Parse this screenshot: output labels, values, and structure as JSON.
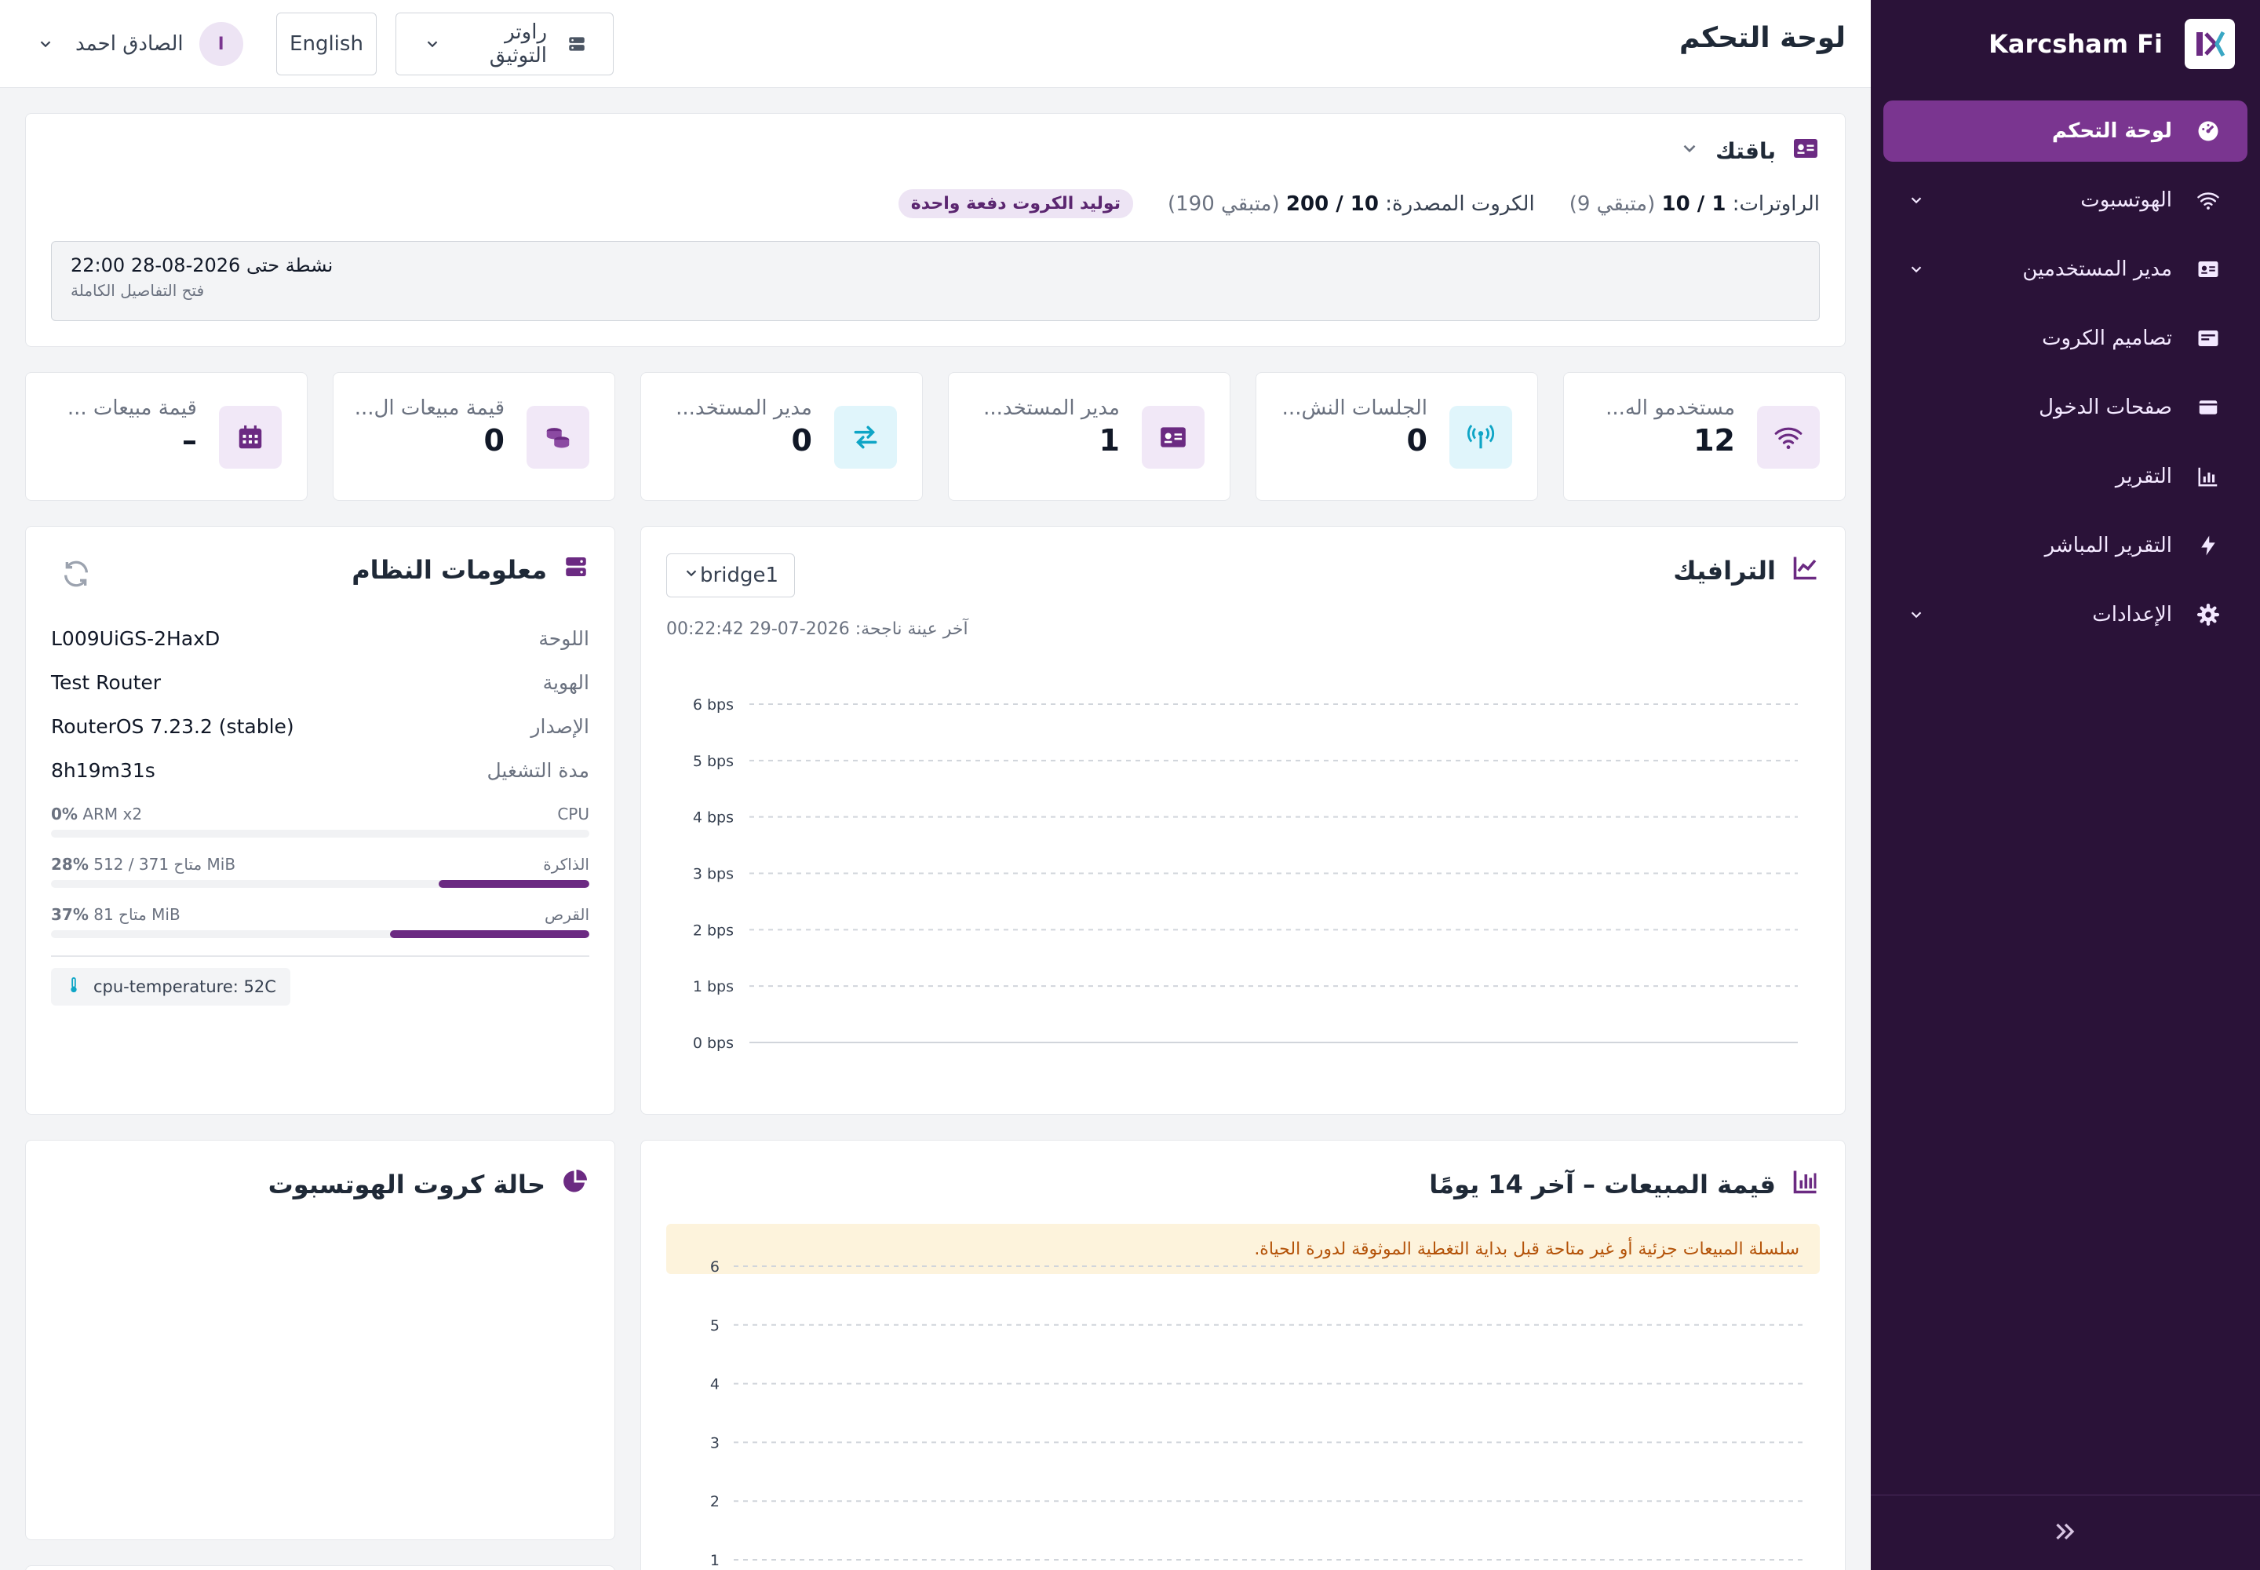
{
  "brand": {
    "name": "Karcsham Fi"
  },
  "sidebar": {
    "items": [
      {
        "label": "لوحة التحكم",
        "icon": "dashboard-icon",
        "active": true
      },
      {
        "label": "الهوتسبوت",
        "icon": "wifi-icon",
        "expandable": true
      },
      {
        "label": "مدير المستخدمين",
        "icon": "id-card-icon",
        "expandable": true
      },
      {
        "label": "تصاميم الكروت",
        "icon": "card-design-icon"
      },
      {
        "label": "صفحات الدخول",
        "icon": "login-page-icon"
      },
      {
        "label": "التقرير",
        "icon": "report-chart-icon"
      },
      {
        "label": "التقرير المباشر",
        "icon": "bolt-icon"
      },
      {
        "label": "الإعدادات",
        "icon": "gear-icon",
        "expandable": true
      }
    ]
  },
  "header": {
    "title": "لوحة التحكم",
    "router_select": "راوتر التوثيق",
    "language": "English",
    "user": {
      "name": "الصادق احمد",
      "initial": "ا"
    }
  },
  "package": {
    "title": "باقتك",
    "routers_label": "الراوترات:",
    "routers_used": "1",
    "routers_total": "10",
    "routers_remaining": "(متبقي 9)",
    "cards_label": "الكروت المصدرة:",
    "cards_used": "10",
    "cards_total": "200",
    "cards_remaining": "(متبقي 190)",
    "badge": "توليد الكروت دفعة واحدة",
    "active_until": "نشطة حتى 2026-08-28 22:00",
    "details_link": "فتح التفاصيل الكاملة"
  },
  "stats": [
    {
      "title": "مستخدمو اله...",
      "value": "12",
      "icon": "wifi-icon"
    },
    {
      "title": "الجلسات النش...",
      "value": "0",
      "icon": "antenna-icon"
    },
    {
      "title": "مدير المستخد...",
      "value": "1",
      "icon": "id-card-icon"
    },
    {
      "title": "مدير المستخد...",
      "value": "0",
      "icon": "transfer-icon"
    },
    {
      "title": "قيمة مبيعات ال...",
      "value": "0",
      "icon": "coins-icon"
    },
    {
      "title": "قيمة مبيعات ...",
      "value": "–",
      "icon": "calendar-icon"
    }
  ],
  "traffic": {
    "title": "الترافيك",
    "interface": "bridge1",
    "last_sample": "آخر عينة ناجحة: 2026-07-29 00:22:42",
    "y_ticks": [
      "0 bps",
      "1 bps",
      "2 bps",
      "3 bps",
      "4 bps",
      "5 bps",
      "6 bps"
    ]
  },
  "system": {
    "title": "معلومات النظام",
    "rows": [
      {
        "key": "اللوحة",
        "value": "L009UiGS-2HaxD"
      },
      {
        "key": "الهوية",
        "value": "Test Router"
      },
      {
        "key": "الإصدار",
        "value": "RouterOS 7.23.2 (stable)"
      },
      {
        "key": "مدة التشغيل",
        "value": "8h19m31s"
      }
    ],
    "meters": [
      {
        "label": "CPU",
        "detail": "ARM x2",
        "percent_text": "0%",
        "percent": 0
      },
      {
        "label": "الذاكرة",
        "detail": "متاح 371 / 512 MiB",
        "percent_text": "28%",
        "percent": 28
      },
      {
        "label": "القرص",
        "detail": "متاح 81 MiB",
        "percent_text": "37%",
        "percent": 37
      }
    ],
    "temperature": "cpu-temperature: 52C"
  },
  "sales": {
    "title": "قيمة المبيعات – آخر 14 يومًا",
    "warning": "سلسلة المبيعات جزئية أو غير متاحة قبل بداية التغطية الموثوقة لدورة الحياة.",
    "y_ticks": [
      "1",
      "2",
      "3",
      "4",
      "5",
      "6"
    ]
  },
  "hotspot_cards": {
    "title": "حالة كروت الهوتسبوت"
  },
  "colors": {
    "sidebar": "#2a1238",
    "accent": "#7a3590",
    "cyan": "#0ea5c6"
  }
}
